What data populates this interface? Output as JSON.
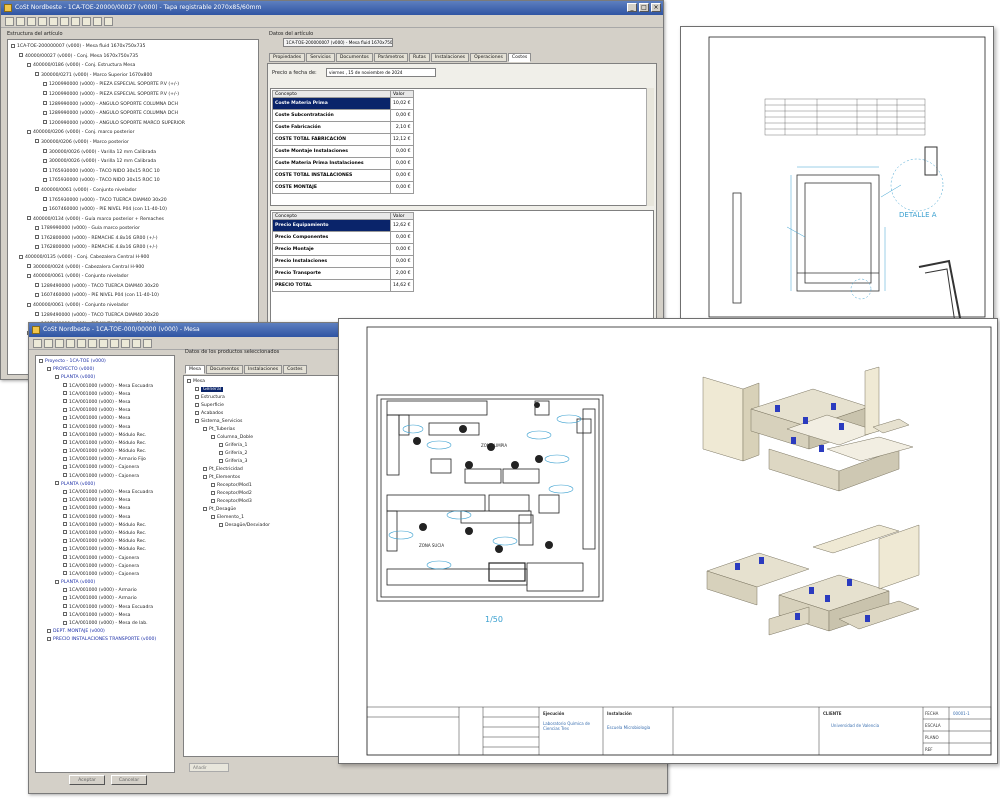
{
  "window_top": {
    "title": "CoSt Nordbeste - 1CA-TOE-20000/00027 (v000) - Tapa registrable 2070x85/60mm",
    "structure_label": "Estructura del artículo",
    "tree": [
      {
        "text": "1CA-TOE-200000007 (v000) - Mesa fluid 1670x750x735",
        "indent": 0,
        "blue": false
      },
      {
        "text": "40000/00027 (v000) - Conj. Mesa 1670x750x735",
        "indent": 1,
        "blue": false
      },
      {
        "text": "400000/0186 (v000) - Conj. Estructura Mesa",
        "indent": 2,
        "blue": false
      },
      {
        "text": "300000/0271 (v000) - Marco Superior 1670x800",
        "indent": 3,
        "blue": false
      },
      {
        "text": "1200990000 (v000) - PIEZA ESPECIAL SOPORTE P.V (+/-)",
        "indent": 4,
        "blue": false
      },
      {
        "text": "1200990000 (v000) - PIEZA ESPECIAL SOPORTE P.V (+/-)",
        "indent": 4,
        "blue": false
      },
      {
        "text": "1289990000 (v000) - ANGULO SOPORTE COLUMNA DCH",
        "indent": 4,
        "blue": false
      },
      {
        "text": "1289990000 (v000) - ANGULO SOPORTE COLUMNA DCH",
        "indent": 4,
        "blue": false
      },
      {
        "text": "1200990000 (v000) - ANGULO SOPORTE MARCO SUPERIOR",
        "indent": 4,
        "blue": false
      },
      {
        "text": "400000/0206 (v000) - Conj. marco posterior",
        "indent": 2,
        "blue": false
      },
      {
        "text": "300000/0206 (v000) - Marco posterior",
        "indent": 3,
        "blue": false
      },
      {
        "text": "300000/0026 (v000) - Varilla 12 mm Calibrada",
        "indent": 4,
        "blue": false
      },
      {
        "text": "300000/0026 (v000) - Varilla 12 mm Calibrada",
        "indent": 4,
        "blue": false
      },
      {
        "text": "1765930000 (v000) - TACO NIDO 30x15 ROC 10",
        "indent": 4,
        "blue": false
      },
      {
        "text": "1765930000 (v000) - TACO NIDO 30x15 ROC 10",
        "indent": 4,
        "blue": false
      },
      {
        "text": "400000/0061 (v000) - Conjunto nivelador",
        "indent": 3,
        "blue": false
      },
      {
        "text": "1765930000 (v000) - TACO TUERCA DIAM40 30x20",
        "indent": 4,
        "blue": false
      },
      {
        "text": "1607460000 (v000) - PIE NIVEL P04 (con 11-40-10)",
        "indent": 4,
        "blue": false
      },
      {
        "text": "400000/0134 (v000) - Guía marco posterior + Remaches",
        "indent": 2,
        "blue": false
      },
      {
        "text": "1789990000 (v000) - Guía marco posterior",
        "indent": 3,
        "blue": false
      },
      {
        "text": "1762800000 (v000) - REMACHE 4.8x16 GR00 (+/-)",
        "indent": 3,
        "blue": false
      },
      {
        "text": "1762800000 (v000) - REMACHE 4.8x16 GR00 (+/-)",
        "indent": 3,
        "blue": false
      },
      {
        "text": "400000/0135 (v000) - Conj. Cabezalera Central H-900",
        "indent": 1,
        "blue": false
      },
      {
        "text": "300000/0024 (v000) - Cabezalera Central H-900",
        "indent": 2,
        "blue": false
      },
      {
        "text": "400000/0061 (v000) - Conjunto nivelador",
        "indent": 2,
        "blue": false
      },
      {
        "text": "1289490000 (v000) - TACO TUERCA DIAM40 30x20",
        "indent": 3,
        "blue": false
      },
      {
        "text": "1607460000 (v000) - PIE NIVEL P04 (con 11-40-10)",
        "indent": 3,
        "blue": false
      },
      {
        "text": "400000/0061 (v000) - Conjunto nivelador",
        "indent": 2,
        "blue": false
      },
      {
        "text": "1289490000 (v000) - TACO TUERCA DIAM40 30x20",
        "indent": 3,
        "blue": false
      },
      {
        "text": "1607460000 (v000) - PIE NIVEL P04 (con 11-40-10)",
        "indent": 3,
        "blue": false
      },
      {
        "text": "400000/0061 (v000) - Conjunto nivelador",
        "indent": 2,
        "blue": false
      },
      {
        "text": "1289490000 (v000) - TACO TUERCA DIAM40 30x20",
        "indent": 3,
        "blue": false
      },
      {
        "text": "1607460000 (v000) - PIE NIVEL P04 (con 11-40-10)",
        "indent": 3,
        "blue": false
      }
    ],
    "data_label": "Datos del artículo",
    "article_field": "1CA-TOE-200000007 (v000) - Mesa fluid 1670x750",
    "tabs": [
      "Propiedades",
      "Servicios",
      "Documentos",
      "Parámetros",
      "Rutas",
      "Instalaciones",
      "Operaciones",
      "Costes"
    ],
    "active_tab": 7,
    "date_label": "Precio a fecha de:",
    "date_value": "viernes , 15 de noviembre de 2024",
    "cost_table": {
      "header": [
        "Concepto",
        "Valor"
      ],
      "rows": [
        {
          "concept": "Coste Materia Prima",
          "value": "10,02 €"
        },
        {
          "concept": "Coste Subcontratación",
          "value": "0,00 €"
        },
        {
          "concept": "Coste Fabricación",
          "value": "2,10 €"
        },
        {
          "concept": "COSTE TOTAL FABRICACIÓN",
          "value": "12,12 €"
        },
        {
          "concept": "Coste Montaje Instalaciones",
          "value": "0,00 €"
        },
        {
          "concept": "Coste Materia Prima Instalaciones",
          "value": "0,00 €"
        },
        {
          "concept": "COSTE TOTAL INSTALACIONES",
          "value": "0,00 €"
        },
        {
          "concept": "COSTE MONTAJE",
          "value": "0,00 €"
        }
      ]
    },
    "price_table": {
      "header": [
        "Concepto",
        "Valor"
      ],
      "rows": [
        {
          "concept": "Precio Equipamiento",
          "value": "12,62 €"
        },
        {
          "concept": "Precio Componentes",
          "value": "0,00 €"
        },
        {
          "concept": "Precio Montaje",
          "value": "0,00 €"
        },
        {
          "concept": "Precio Instalaciones",
          "value": "0,00 €"
        },
        {
          "concept": "Precio Transporte",
          "value": "2,00 €"
        },
        {
          "concept": "PRECIO TOTAL",
          "value": "14,62 €"
        }
      ]
    }
  },
  "window_bottom": {
    "title": "CoSt Nordbeste - 1CA-TOE-000/00000 (v000) - Mesa",
    "tree": [
      {
        "text": "Proyecto - 1CA-TOE (v000)",
        "indent": 0,
        "blue": true
      },
      {
        "text": "PROYECTO (v000)",
        "indent": 1,
        "blue": true
      },
      {
        "text": "PLANTA (v000)",
        "indent": 2,
        "blue": true
      },
      {
        "text": "1CA/001000 (v000) - Mesa Escuadra",
        "indent": 3,
        "blue": false
      },
      {
        "text": "1CA/001000 (v000) - Mesa",
        "indent": 3,
        "blue": false
      },
      {
        "text": "1CA/001000 (v000) - Mesa",
        "indent": 3,
        "blue": false
      },
      {
        "text": "1CA/001000 (v000) - Mesa",
        "indent": 3,
        "blue": false
      },
      {
        "text": "1CA/001000 (v000) - Mesa",
        "indent": 3,
        "blue": false
      },
      {
        "text": "1CA/001000 (v000) - Mesa",
        "indent": 3,
        "blue": false
      },
      {
        "text": "1CA/001000 (v000) - Módulo Rec.",
        "indent": 3,
        "blue": false
      },
      {
        "text": "1CA/001000 (v000) - Módulo Rec.",
        "indent": 3,
        "blue": false
      },
      {
        "text": "1CA/001000 (v000) - Módulo Rec.",
        "indent": 3,
        "blue": false
      },
      {
        "text": "1CA/001000 (v000) - Armario Fijo",
        "indent": 3,
        "blue": false
      },
      {
        "text": "1CA/001000 (v000) - Cajonera",
        "indent": 3,
        "blue": false
      },
      {
        "text": "1CA/001000 (v000) - Cajonera",
        "indent": 3,
        "blue": false
      },
      {
        "text": "PLANTA (v000)",
        "indent": 2,
        "blue": true
      },
      {
        "text": "1CA/001000 (v000) - Mesa Escuadra",
        "indent": 3,
        "blue": false
      },
      {
        "text": "1CA/001000 (v000) - Mesa",
        "indent": 3,
        "blue": false
      },
      {
        "text": "1CA/001000 (v000) - Mesa",
        "indent": 3,
        "blue": false
      },
      {
        "text": "1CA/001000 (v000) - Mesa",
        "indent": 3,
        "blue": false
      },
      {
        "text": "1CA/001000 (v000) - Módulo Rec.",
        "indent": 3,
        "blue": false
      },
      {
        "text": "1CA/001000 (v000) - Módulo Rec.",
        "indent": 3,
        "blue": false
      },
      {
        "text": "1CA/001000 (v000) - Módulo Rec.",
        "indent": 3,
        "blue": false
      },
      {
        "text": "1CA/001000 (v000) - Módulo Rec.",
        "indent": 3,
        "blue": false
      },
      {
        "text": "1CA/001000 (v000) - Cajonera",
        "indent": 3,
        "blue": false
      },
      {
        "text": "1CA/001000 (v000) - Cajonera",
        "indent": 3,
        "blue": false
      },
      {
        "text": "1CA/001000 (v000) - Cajonera",
        "indent": 3,
        "blue": false
      },
      {
        "text": "PLANTA (v000)",
        "indent": 2,
        "blue": true
      },
      {
        "text": "1CA/001000 (v000) - Armario",
        "indent": 3,
        "blue": false
      },
      {
        "text": "1CA/001000 (v000) - Armario",
        "indent": 3,
        "blue": false
      },
      {
        "text": "1CA/001000 (v000) - Mesa Escuadra",
        "indent": 3,
        "blue": false
      },
      {
        "text": "1CA/001000 (v000) - Mesa",
        "indent": 3,
        "blue": false
      },
      {
        "text": "1CA/001000 (v000) - Mesa de lab.",
        "indent": 3,
        "blue": false
      },
      {
        "text": "DEPT. MONTAJE (v000)",
        "indent": 1,
        "blue": true
      },
      {
        "text": "PRECIO INSTALACIONES TRANSPORTE (v000)",
        "indent": 1,
        "blue": true
      }
    ],
    "data_label": "Datos de los productos seleccionados",
    "tabs": [
      "Mesa",
      "Documentos",
      "Instalaciones",
      "Costes"
    ],
    "active_tab": 0,
    "detail_tree": [
      {
        "text": "Mesa",
        "indent": 0,
        "sel": false
      },
      {
        "text": "General",
        "indent": 1,
        "sel": true
      },
      {
        "text": "Estructura",
        "indent": 1,
        "sel": false
      },
      {
        "text": "Superficie",
        "indent": 1,
        "sel": false
      },
      {
        "text": "Acabados",
        "indent": 1,
        "sel": false
      },
      {
        "text": "Sistema_Servicios",
        "indent": 1,
        "sel": false
      },
      {
        "text": "Pt_Tuberías",
        "indent": 2,
        "sel": false
      },
      {
        "text": "Columna_Doble",
        "indent": 3,
        "sel": false
      },
      {
        "text": "Grifería_1",
        "indent": 4,
        "sel": false
      },
      {
        "text": "Grifería_2",
        "indent": 4,
        "sel": false
      },
      {
        "text": "Grifería_3",
        "indent": 4,
        "sel": false
      },
      {
        "text": "Pt_Electricidad",
        "indent": 2,
        "sel": false
      },
      {
        "text": "Pt_Elementos",
        "indent": 2,
        "sel": false
      },
      {
        "text": "Receptor/Mod1",
        "indent": 3,
        "sel": false
      },
      {
        "text": "Receptor/Mod2",
        "indent": 3,
        "sel": false
      },
      {
        "text": "Receptor/Mod3",
        "indent": 3,
        "sel": false
      },
      {
        "text": "Pt_Desagüe",
        "indent": 2,
        "sel": false
      },
      {
        "text": "Elemento_1",
        "indent": 3,
        "sel": false
      },
      {
        "text": "Desagüe/Desviador",
        "indent": 4,
        "sel": false
      }
    ],
    "buttons": [
      "Aceptar",
      "Cancelar"
    ],
    "bottom_field": "Añadir"
  },
  "drawing_top": {
    "detail_label": "DETALLE A",
    "bom_header": [
      "Nº pieza",
      "Nº artículo",
      "Tipo",
      "Cantidad",
      "Peso",
      "Cod_Artículo"
    ]
  },
  "drawing_main": {
    "zone_labels": [
      "ZONA LIMPIA",
      "ZONA SUCIA"
    ],
    "scale_text": "1/50",
    "title_block": {
      "obra_label": "Ejecución",
      "obra_value": "Laboratorio Química de Ciencias Tres",
      "plano_label": "Instalación",
      "plano_value": "Escuela Microbiología",
      "cliente_label": "CLIENTE",
      "cliente_value": "Universidad de Valencia",
      "fecha_label": "FECHA",
      "escala_label": "ESCALA",
      "plano_num_label": "PLANO",
      "plano_num_value": "00001-1",
      "ref_label": "REF"
    }
  }
}
